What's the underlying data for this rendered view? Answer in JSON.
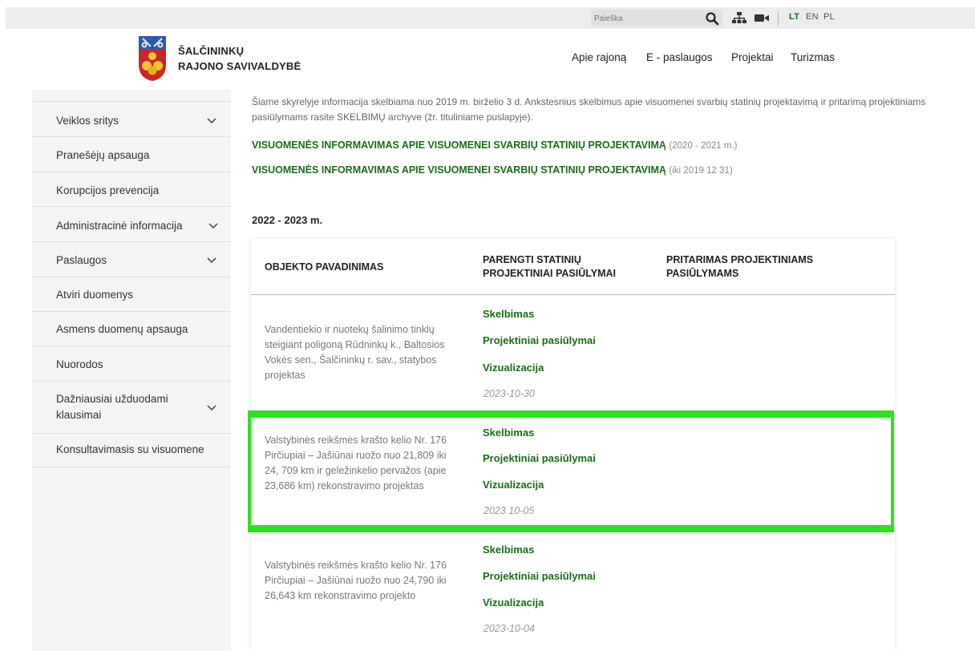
{
  "topbar": {
    "search_placeholder": "Paieška",
    "icons": [
      "search-icon",
      "sitemap-icon",
      "video-icon"
    ],
    "languages": [
      "LT",
      "EN",
      "PL"
    ],
    "active_language": "LT"
  },
  "header": {
    "logo_line1": "ŠALČININKŲ",
    "logo_line2": "RAJONO SAVIVALDYBĖ",
    "nav": [
      "Apie rajoną",
      "E - paslaugos",
      "Projektai",
      "Turizmas"
    ]
  },
  "sidebar": {
    "items": [
      {
        "label": "Veiklos sritys",
        "has_submenu": true
      },
      {
        "label": "Pranešėjų apsauga",
        "has_submenu": false
      },
      {
        "label": "Korupcijos prevencija",
        "has_submenu": false
      },
      {
        "label": "Administracinė informacija",
        "has_submenu": true
      },
      {
        "label": "Paslaugos",
        "has_submenu": true
      },
      {
        "label": "Atviri duomenys",
        "has_submenu": false
      },
      {
        "label": "Asmens duomenų apsauga",
        "has_submenu": false
      },
      {
        "label": "Nuorodos",
        "has_submenu": false
      },
      {
        "label": "Dažniausiai užduodami klausimai",
        "has_submenu": true
      },
      {
        "label": "Konsultavimasis su visuomene",
        "has_submenu": false
      }
    ]
  },
  "content": {
    "intro": "Šiame skyrelyje informacija skelbiama nuo 2019 m. birželio 3 d. Ankstesnius skelbimus apie visuomenei svarbių statinių projektavimą ir pritarimą projektiniams pasiūlymams rasite SKELBIMŲ archyve (žr. tituliniame puslapyje).",
    "archive_links": [
      {
        "text": "VISUOMENĖS INFORMAVIMAS APIE VISUOMENEI SVARBIŲ STATINIŲ PROJEKTAVIMĄ",
        "note": "(2020  - 2021 m.)"
      },
      {
        "text": "VISUOMENĖS INFORMAVIMAS APIE VISUOMENEI SVARBIŲ STATINIŲ PROJEKTAVIMĄ",
        "note": "(iki 2019 12 31)"
      }
    ],
    "year_heading": "2022 - 2023 m.",
    "table": {
      "headers": [
        "OBJEKTO PAVADINIMAS",
        "PARENGTI STATINIŲ PROJEKTINIAI PASIŪLYMAI",
        "PRITARIMAS PROJEKTINIAMS PASIŪLYMAMS"
      ],
      "rows": [
        {
          "name": "Vandentiekio ir nuotekų šalinimo tinklų steigiant poligoną Rūdninkų k., Baltosios Vokės sen., Šalčininkų r. sav., statybos projektas",
          "links": [
            "Skelbimas",
            "Projektiniai pasiūlymai",
            "Vizualizacija"
          ],
          "date": "2023-10-30"
        },
        {
          "name": " Valstybinės reikšmės krašto kelio Nr. 176 Pirčiupiai – Jašiūnai ruožo nuo 21,809 iki 24, 709 km ir geležinkelio pervažos (apie 23,686 km) rekonstravimo projektas",
          "links": [
            "Skelbimas",
            "Projektiniai pasiūlymai",
            "Vizualizacija"
          ],
          "date": "2023 10-05"
        },
        {
          "name": "Valstybinės reikšmės krašto kelio Nr. 176 Pirčiupiai – Jašiūnai ruožo nuo 24,790 iki 26,643 km rekonstravimo projekto",
          "links": [
            "Skelbimas",
            "Projektiniai pasiūlymai",
            "Vizualizacija"
          ],
          "date": "2023-10-04"
        }
      ]
    }
  },
  "colors": {
    "accent_green": "#1a6b18",
    "highlight": "#2be21c",
    "sidebar_bg": "#f4f4f4"
  }
}
